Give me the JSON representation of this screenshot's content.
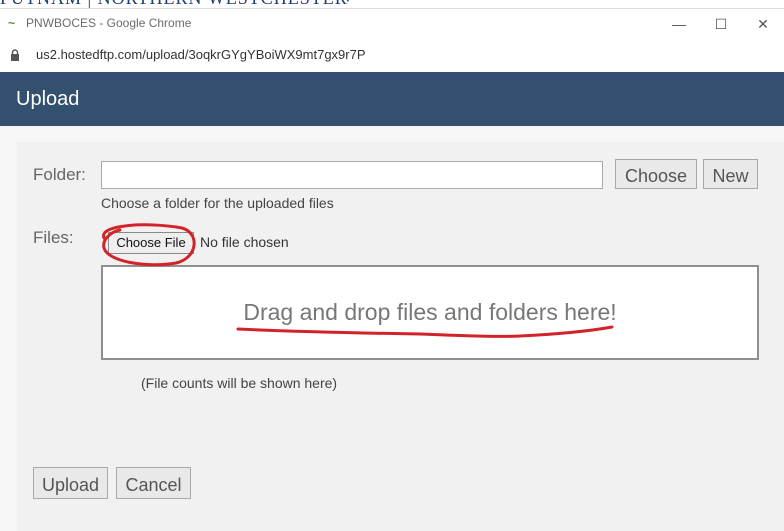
{
  "background_page": {
    "partial_text": "PUTNAM | NORTHERN WESTCHESTER"
  },
  "window": {
    "title": "PNWBOCES - Google Chrome",
    "url": "us2.hostedftp.com/upload/3oqkrGYgYBoiWX9mt7gx9r7P",
    "controls": {
      "minimize": "—",
      "maximize": "☐",
      "close": "✕"
    }
  },
  "header": {
    "title": "Upload"
  },
  "form": {
    "folder_label": "Folder:",
    "folder_value": "",
    "choose_label": "Choose",
    "new_label": "New",
    "folder_hint": "Choose a folder for the uploaded files",
    "files_label": "Files:",
    "choose_file_label": "Choose File",
    "no_file_text": "No file chosen",
    "drop_text": "Drag and drop files and folders here!",
    "file_counts_text": "(File counts will be shown here)"
  },
  "footer": {
    "upload_label": "Upload",
    "cancel_label": "Cancel"
  },
  "colors": {
    "header_bg": "#34506f",
    "annotation_red": "#d2232a"
  },
  "icons": {
    "site": "hostedftp-icon",
    "lock": "lock-icon"
  }
}
